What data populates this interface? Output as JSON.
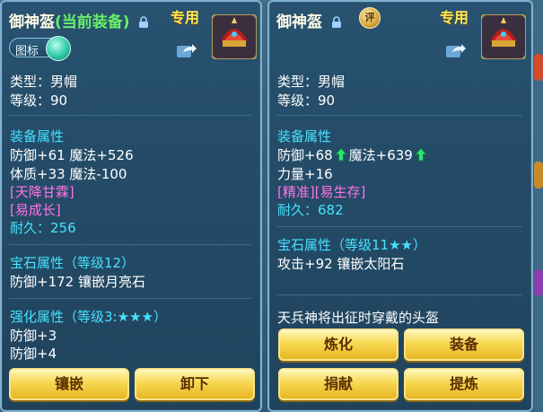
{
  "left": {
    "title": "御神盔",
    "title_note": "(当前装备)",
    "exclusive": "专用",
    "toggle_label": "图标",
    "type_line": "类型：男帽",
    "level_line": "等级：90",
    "attr_header": "装备属性",
    "attr_line1": "防御+61 魔法+526",
    "attr_line2": "体质+33 魔法-100",
    "special1": "[天降甘霖]",
    "special2": "[易成长]",
    "durability": "耐久：256",
    "gem_header": "宝石属性（等级12）",
    "gem_line": "防御+172 镶嵌月亮石",
    "enhance_header": "强化属性（等级3:★★★）",
    "enhance_line1": "防御+3",
    "enhance_line2": "防御+4",
    "btn_inlay": "镶嵌",
    "btn_unequip": "卸下"
  },
  "right": {
    "title": "御神盔",
    "badge": "评",
    "exclusive": "专用",
    "type_line": "类型：男帽",
    "level_line": "等级：90",
    "attr_header": "装备属性",
    "attr_def": "防御+68",
    "attr_magic": "魔法+639",
    "attr_str": "力量+16",
    "special": "[精准][易生存]",
    "durability": "耐久：682",
    "gem_header": "宝石属性（等级11★★）",
    "gem_line": "攻击+92 镶嵌太阳石",
    "description": "天兵神将出征时穿戴的头盔",
    "btn_refine": "炼化",
    "btn_equip": "装备",
    "btn_donate": "捐献",
    "btn_extract": "提炼"
  },
  "colors": {
    "accent_green": "#68f06a",
    "stat_cyan": "#47e2ff",
    "special_pink": "#ff73e6",
    "exclusive_gold": "#ffe55a",
    "button_gold": "#f7d852"
  },
  "icons": [
    "lock-icon",
    "share-icon",
    "helmet-icon",
    "arrow-up-icon",
    "rating-badge-icon"
  ]
}
